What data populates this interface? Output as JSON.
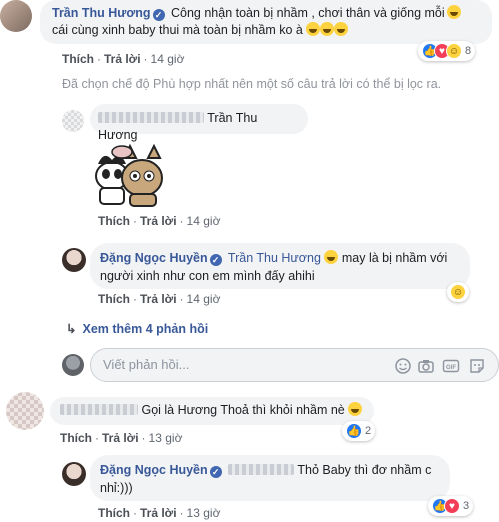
{
  "comment1": {
    "author": "Trần Thu Hương",
    "text_line1": "Công nhận toàn bị nhầm , chơi thân và giống mỗi",
    "text_line2": "cái cùng xinh baby thui mà toàn bị nhầm ko à",
    "like": "Thích",
    "reply": "Trả lời",
    "time": "14 giờ",
    "reaction_count": "8"
  },
  "filter_notice": "Đã chọn chế độ Phù hợp nhất nên một số câu trả lời có thể bị lọc ra.",
  "reply1": {
    "tag": "Trần Thu Hương",
    "like": "Thích",
    "reply": "Trả lời",
    "time": "14 giờ"
  },
  "reply2": {
    "author": "Đặng Ngọc Huyền",
    "tag": "Trần Thu Hương",
    "text_line1": "may là bị nhầm với",
    "text_line2": "người xinh như con em mình đấy ahihi",
    "like": "Thích",
    "reply": "Trả lời",
    "time": "14 giờ"
  },
  "more_replies": "Xem thêm 4 phản hồi",
  "composer": {
    "placeholder": "Viết phản hồi..."
  },
  "comment2": {
    "text": "Gọi là Hương Thoả thì khỏi nhầm nè",
    "like": "Thích",
    "reply": "Trả lời",
    "time": "13 giờ",
    "reaction_count": "2"
  },
  "reply3": {
    "author": "Đặng Ngọc Huyền",
    "text_line1": "Thỏ Baby thì đơ nhầm c",
    "text_line2": "nhỉ:)))",
    "like": "Thích",
    "reply": "Trả lời",
    "time": "13 giờ",
    "reaction_count": "3"
  },
  "colors": {
    "name_link": "#385898",
    "bubble": "#f2f3f5",
    "meta": "#606770",
    "like_blue": "#2078f4"
  },
  "icons": [
    "verified-icon",
    "like-reaction-icon",
    "love-reaction-icon",
    "haha-reaction-icon",
    "reply-arrow-icon",
    "smiley-icon",
    "camera-icon",
    "gif-icon",
    "sticker-icon"
  ]
}
